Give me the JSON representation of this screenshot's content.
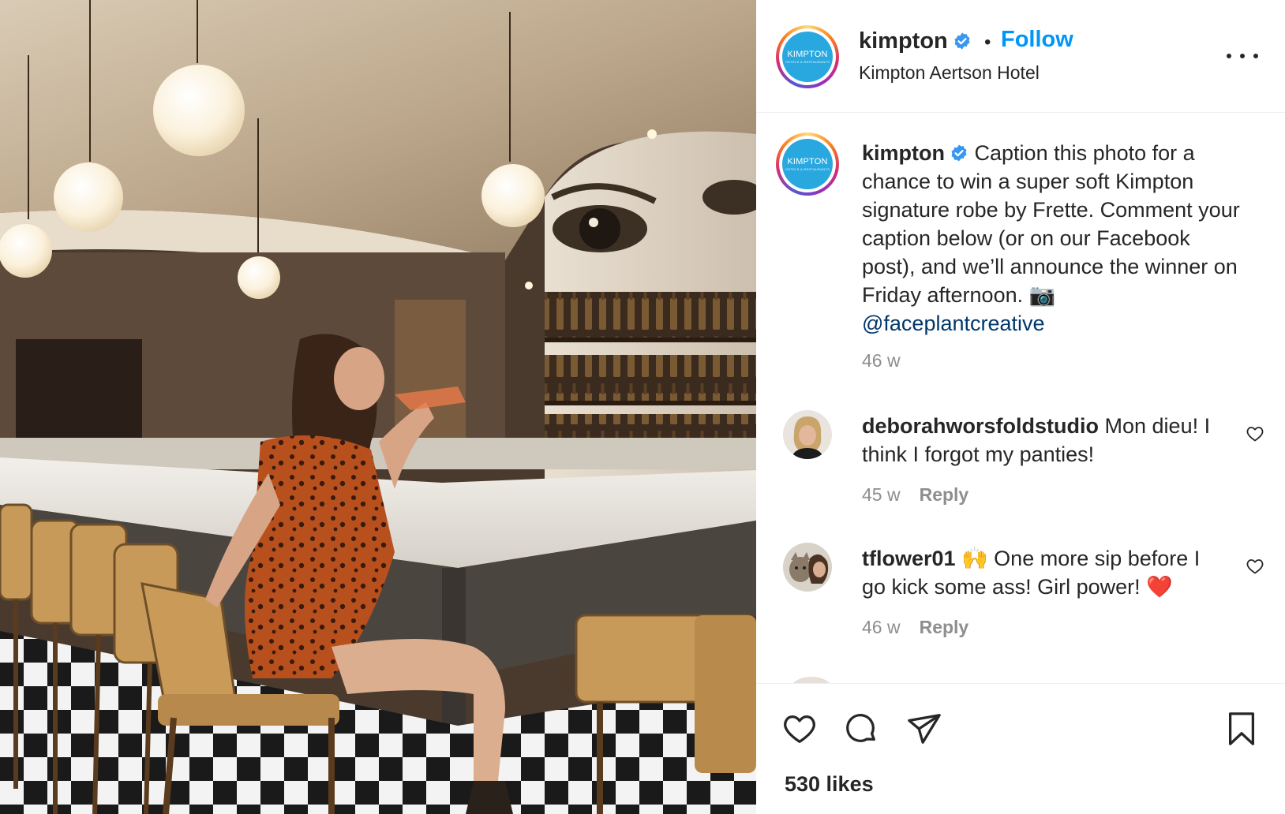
{
  "post": {
    "image_alt": "Woman in leopard-print dress drinking a cocktail at a hotel bar",
    "logo": {
      "brand": "KIMPTON",
      "tagline": "HOTELS & RESTAURANTS"
    }
  },
  "header": {
    "username": "kimpton",
    "separator": "•",
    "follow_label": "Follow",
    "location": "Kimpton Aertson Hotel"
  },
  "caption": {
    "username": "kimpton",
    "text": "Caption this photo for a chance to win a super soft Kimpton signature robe by Frette. Comment your caption below (or on our Facebook post), and we’ll announce the winner on Friday afternoon. 📷",
    "mention": "@faceplantcreative",
    "time": "46 w"
  },
  "comments": [
    {
      "username": "deborahworsfoldstudio",
      "text": "Mon dieu! I think I forgot my panties!",
      "time": "45 w",
      "reply_label": "Reply"
    },
    {
      "username": "tflower01",
      "text": "🙌 One more sip before I go kick some ass! Girl power! ❤️",
      "time": "46 w",
      "reply_label": "Reply"
    }
  ],
  "footer": {
    "likes": "530 likes"
  },
  "colors": {
    "accent": "#0095f6",
    "verified": "#3897f0",
    "mention": "#00376b",
    "secondary_text": "#8e8e8e",
    "logo_blue": "#29a8e0"
  },
  "icons": [
    "verified-badge-icon",
    "more-options-icon",
    "heart-icon",
    "comment-icon",
    "share-icon",
    "bookmark-icon"
  ]
}
